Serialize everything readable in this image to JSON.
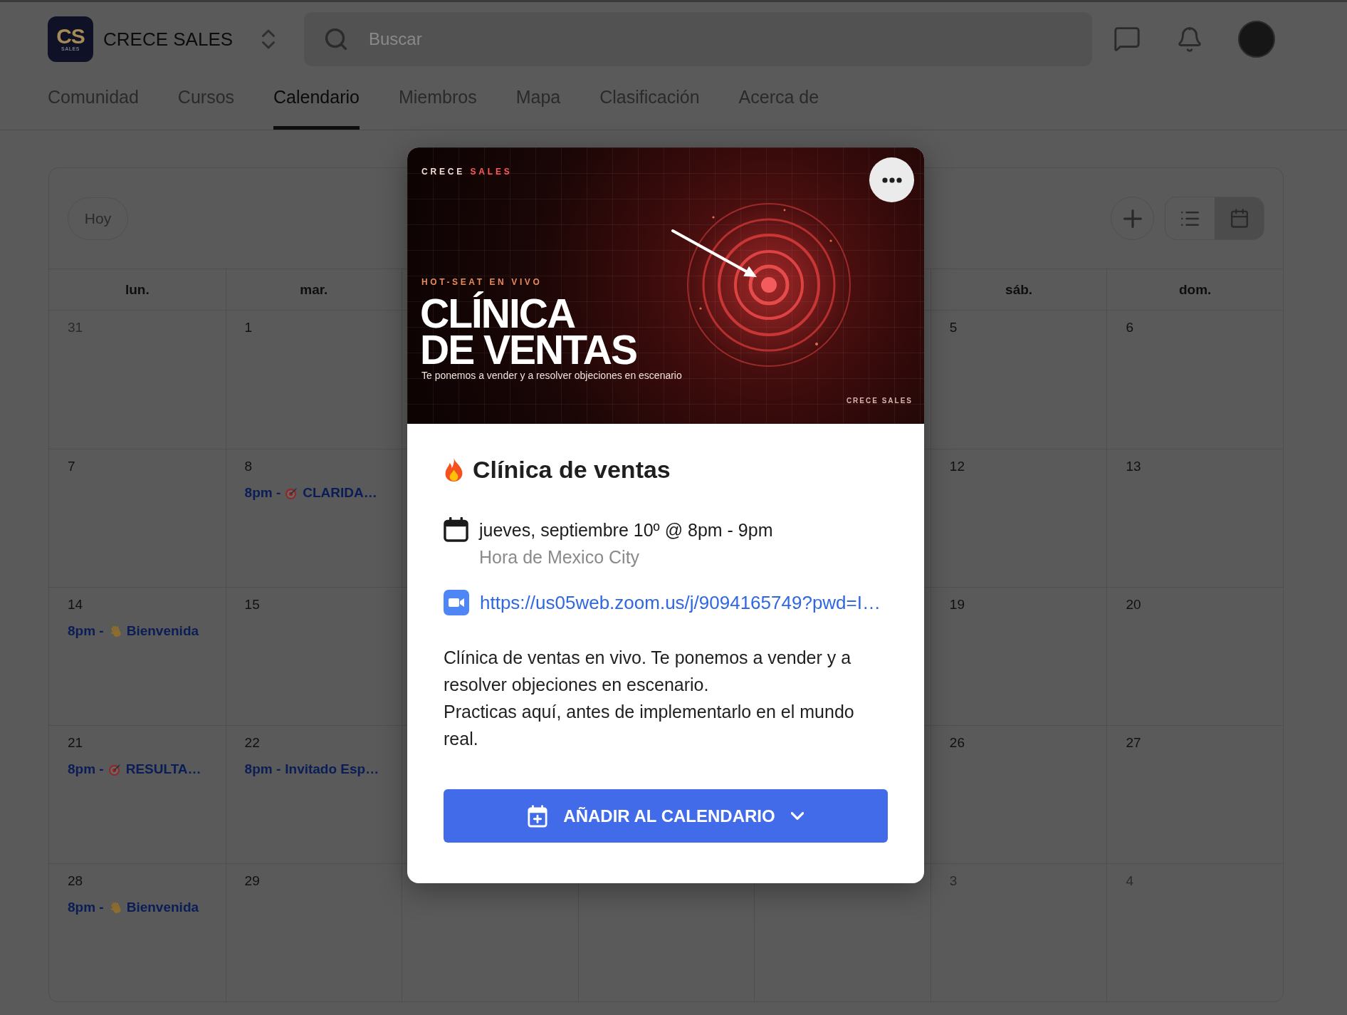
{
  "header": {
    "logo": {
      "monogram": "CS",
      "caption": "SALES"
    },
    "community_name": "CRECE SALES",
    "search": {
      "placeholder": "Buscar"
    }
  },
  "nav_tabs": [
    {
      "label": "Comunidad",
      "selected": false
    },
    {
      "label": "Cursos",
      "selected": false
    },
    {
      "label": "Calendario",
      "selected": true
    },
    {
      "label": "Miembros",
      "selected": false
    },
    {
      "label": "Mapa",
      "selected": false
    },
    {
      "label": "Clasificación",
      "selected": false
    },
    {
      "label": "Acerca de",
      "selected": false
    }
  ],
  "calendar": {
    "today_button": "Hoy",
    "views": [
      {
        "kind": "list",
        "selected": false
      },
      {
        "kind": "month",
        "selected": true
      }
    ],
    "weekdays": {
      "left": [
        "lun.",
        "mar."
      ],
      "right": [
        "sáb.",
        "dom."
      ]
    },
    "weeks": [
      {
        "left": [
          {
            "day": "31",
            "outside_month": true
          },
          {
            "day": "1",
            "outside_month": false
          }
        ],
        "right": [
          {
            "day": "5",
            "outside_month": false
          },
          {
            "day": "6",
            "outside_month": false
          }
        ]
      },
      {
        "left": [
          {
            "day": "7",
            "outside_month": false
          },
          {
            "day": "8",
            "outside_month": false,
            "events": [
              {
                "time": "8pm -",
                "kind": "target",
                "title": "CLARIDA…"
              }
            ]
          }
        ],
        "right": [
          {
            "day": "12",
            "outside_month": false
          },
          {
            "day": "13",
            "outside_month": false
          }
        ]
      },
      {
        "left": [
          {
            "day": "14",
            "outside_month": false,
            "events": [
              {
                "time": "8pm -",
                "kind": "wave",
                "title": "Bienvenida"
              }
            ]
          },
          {
            "day": "15",
            "outside_month": false
          }
        ],
        "right": [
          {
            "day": "19",
            "outside_month": false
          },
          {
            "day": "20",
            "outside_month": false
          }
        ]
      },
      {
        "left": [
          {
            "day": "21",
            "outside_month": false,
            "events": [
              {
                "time": "8pm -",
                "kind": "target",
                "title": "RESULTA…"
              }
            ]
          },
          {
            "day": "22",
            "outside_month": false,
            "events": [
              {
                "time": "8pm -",
                "kind": "plain",
                "title": "Invitado Esp…"
              }
            ]
          }
        ],
        "right": [
          {
            "day": "26",
            "outside_month": false
          },
          {
            "day": "27",
            "outside_month": false
          }
        ]
      },
      {
        "left": [
          {
            "day": "28",
            "outside_month": false,
            "events": [
              {
                "time": "8pm -",
                "kind": "wave",
                "title": "Bienvenida"
              }
            ]
          },
          {
            "day": "29",
            "outside_month": false
          }
        ],
        "right": [
          {
            "day": "3",
            "outside_month": true
          },
          {
            "day": "4",
            "outside_month": true
          }
        ]
      }
    ]
  },
  "event_modal": {
    "banner": {
      "brand_words": [
        "CRECE",
        "SALES"
      ],
      "eyebrow": "HOT-SEAT EN VIVO",
      "headline_lines": [
        "CLÍNICA",
        "DE VENTAS"
      ],
      "tagline": "Te ponemos a vender y a resolver objeciones en escenario",
      "footer_brand": "CRECE SALES"
    },
    "title": "Clínica de ventas",
    "when": "jueves, septiembre 10º @ 8pm - 9pm",
    "timezone": "Hora de Mexico City",
    "meeting_link": "https://us05web.zoom.us/j/9094165749?pwd=I…",
    "description": [
      "Clínica de ventas en vivo. Te ponemos a vender y a resolver objeciones en escenario.",
      "Practicas aquí, antes de implementarlo en el mundo real."
    ],
    "add_button": "AÑADIR AL CALENDARIO"
  }
}
